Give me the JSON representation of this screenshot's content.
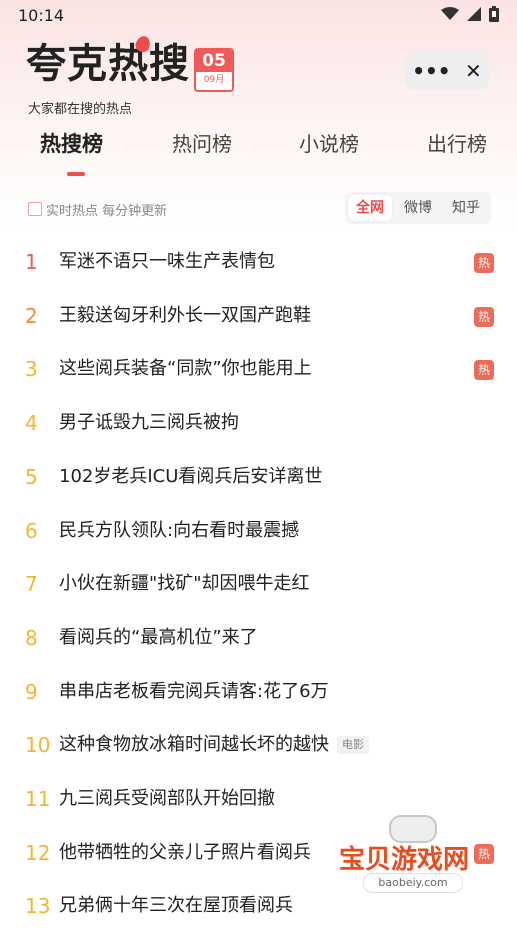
{
  "status": {
    "time": "10:14"
  },
  "header": {
    "logo_text": "夸克热搜",
    "date_day": "05",
    "date_month": "09月",
    "tagline": "大家都在搜的热点"
  },
  "tabs": [
    {
      "label": "热搜榜",
      "active": true
    },
    {
      "label": "热问榜",
      "active": false
    },
    {
      "label": "小说榜",
      "active": false
    },
    {
      "label": "出行榜",
      "active": false
    }
  ],
  "filter": {
    "realtime_label": "实时热点 每分钟更新",
    "segments": [
      {
        "label": "全网",
        "active": true
      },
      {
        "label": "微博",
        "active": false
      },
      {
        "label": "知乎",
        "active": false
      }
    ]
  },
  "list": [
    {
      "rank": "1",
      "title": "军迷不语只一味生产表情包",
      "badge": "热"
    },
    {
      "rank": "2",
      "title": "王毅送匈牙利外长一双国产跑鞋",
      "badge": "热"
    },
    {
      "rank": "3",
      "title": "这些阅兵装备“同款”你也能用上",
      "badge": "热"
    },
    {
      "rank": "4",
      "title": "男子诋毁九三阅兵被拘",
      "badge": ""
    },
    {
      "rank": "5",
      "title": "102岁老兵ICU看阅兵后安详离世",
      "badge": ""
    },
    {
      "rank": "6",
      "title": "民兵方队领队:向右看时最震撼",
      "badge": ""
    },
    {
      "rank": "7",
      "title": "小伙在新疆\"找矿\"却因喂牛走红",
      "badge": ""
    },
    {
      "rank": "8",
      "title": "看阅兵的“最高机位”来了",
      "badge": ""
    },
    {
      "rank": "9",
      "title": "串串店老板看完阅兵请客:花了6万",
      "badge": ""
    },
    {
      "rank": "10",
      "title": "这种食物放冰箱时间越长坏的越快",
      "badge": "",
      "tag": "电影"
    },
    {
      "rank": "11",
      "title": "九三阅兵受阅部队开始回撤",
      "badge": ""
    },
    {
      "rank": "12",
      "title": "他带牺牲的父亲儿子照片看阅兵",
      "badge": "热"
    },
    {
      "rank": "13",
      "title": "兄弟俩十年三次在屋顶看阅兵",
      "badge": ""
    }
  ],
  "watermark": {
    "text": "宝贝游戏网",
    "url": "baobeiy.com"
  },
  "colors": {
    "accent": "#f04a4a",
    "rank_top": "#f0584a",
    "rank_second": "#f08a3a",
    "rank_other": "#f5b531",
    "hot_badge": "#f06a5a"
  },
  "icons": [
    "wifi-icon",
    "signal-icon",
    "battery-icon",
    "more-icon",
    "close-icon",
    "flame-icon",
    "checkbox-icon"
  ]
}
